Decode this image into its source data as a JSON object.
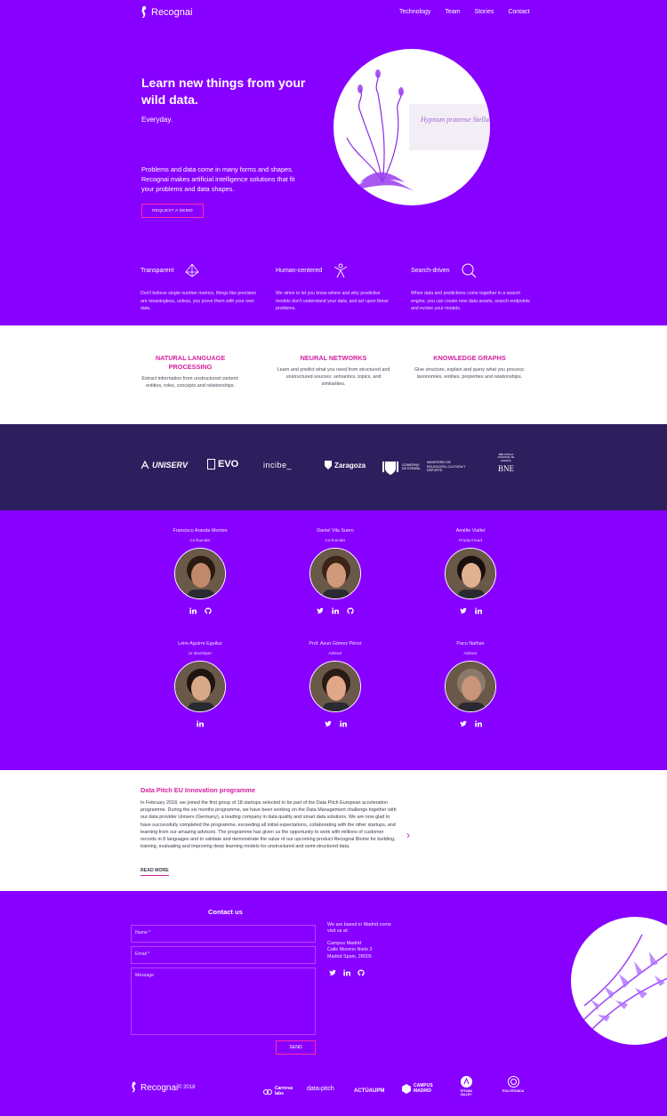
{
  "header": {
    "brand": "Recognai",
    "nav": [
      "Technology",
      "Team",
      "Stories",
      "Contact"
    ]
  },
  "hero": {
    "title": "Learn new things from your wild data.",
    "subtitle": "Everyday.",
    "text": "Problems and data come in many forms and shapes. Recognai makes artificial intelligence solutions that fit your problems and data shapes.",
    "cta": "REQUEST A DEMO",
    "circle_caption": "Hypnum pratense Stellatum"
  },
  "features": [
    {
      "title": "Transparent",
      "icon": "pyramid-icon",
      "text": "Don't believe single number metrics, things like precision are meaningless, unless, you prove them with your own data."
    },
    {
      "title": "Human-centered",
      "icon": "person-icon",
      "text": "We strive to let you know where and why predictive models don't understand your data, and act upon these problems."
    },
    {
      "title": "Search-driven",
      "icon": "search-icon",
      "text": "When data and predictions come together in a search engine, you can create new data assets, search endpoints and evolve your models."
    }
  ],
  "technologies": [
    {
      "title": "NATURAL LANGUAGE PROCESSING",
      "text": "Extract information from unstructured content: entities, roles, concepts and relationships."
    },
    {
      "title": "NEURAL NETWORKS",
      "text": "Learn and predict what you need from structured and unstructured sources: semantics, topics, and similarities."
    },
    {
      "title": "KNOWLEDGE GRAPHS",
      "text": "Give structure, explain and query what you process: taxonomies, entities, properties and relationships."
    }
  ],
  "partners": [
    "UNISERV",
    "EVO",
    "incibe_",
    "Zaragoza",
    "GOBIERNO DE ESPAÑA",
    "MINISTERIO DE EDUCACIÓN, CULTURA Y DEPORTE",
    "BIBLIOTECA NACIONAL DE ESPAÑA",
    "BNE"
  ],
  "team": [
    {
      "name": "Francisco Aranda Montes",
      "role": "Co-founder",
      "socials": [
        "linkedin-icon",
        "github-icon"
      ],
      "skin": "#c08a6a",
      "hair": "#2a1a12"
    },
    {
      "name": "Daniel Vila Suero",
      "role": "Co-founder",
      "socials": [
        "twitter-icon",
        "linkedin-icon",
        "github-icon"
      ],
      "skin": "#d09a7a",
      "hair": "#3a2418"
    },
    {
      "name": "Amélie Viallet",
      "role": "Product lead",
      "socials": [
        "twitter-icon",
        "linkedin-icon"
      ],
      "skin": "#e0b090",
      "hair": "#1a1010"
    },
    {
      "name": "Leire Aguirre Eguiluz",
      "role": "UI developer",
      "socials": [
        "linkedin-icon"
      ],
      "skin": "#d8a888",
      "hair": "#1f1410"
    },
    {
      "name": "Prof. Asun Gómez Pérez",
      "role": "Advisor",
      "socials": [
        "twitter-icon",
        "linkedin-icon"
      ],
      "skin": "#e0a888",
      "hair": "#2a1a14"
    },
    {
      "name": "Paco Nathan",
      "role": "Advisor",
      "socials": [
        "twitter-icon",
        "linkedin-icon"
      ],
      "skin": "#c8957a",
      "hair": "#8a7a6a"
    }
  ],
  "news": {
    "title": "Data Pitch EU Innovation programme",
    "text": "In February 2018, we joined the first group of 18 startups selected to be part of the Data Pitch European acceleration programme. During the six months programme, we have been working on the Data Management challenge together with our data provider Uniserv (Germany), a leading company in data quality and smart data solutions. We are now glad to have successfully completed the programme, exceeding all initial expectations, collaborating with the other startups, and learning from our amazing advisors. The programme has given us the opportunity to work with millions of customer records in 8 languages and to validate and demonstrate the value of our upcoming product Recognai Biome for building, training, evaluating and improving deep learning models for unstructured and semi-structured data.",
    "read_more": "READ MORE",
    "next": "›"
  },
  "contact": {
    "title": "Contact us",
    "name_placeholder": "Name *",
    "email_placeholder": "Email *",
    "message_placeholder": "Message",
    "send": "SEND",
    "address_intro": "We are based in Madrid come visit us at:",
    "address_lines": [
      "Campus Madrid",
      "Calle Moreno Nieto 2",
      "Madrid Spain, 28005"
    ]
  },
  "footer": {
    "brand": "Recognai",
    "copyright": "© 2018",
    "sponsors": [
      "Carreras labs",
      "data›pitch",
      "ACTÚAUPM",
      "CAMPUS MADRID",
      "TETUAN VALLEY",
      "POLITÉCNICA"
    ]
  },
  "colors": {
    "primary": "#8800ff",
    "accent": "#d41ea0",
    "dark": "#2d1f5e",
    "button_border": "#ff2db3"
  }
}
